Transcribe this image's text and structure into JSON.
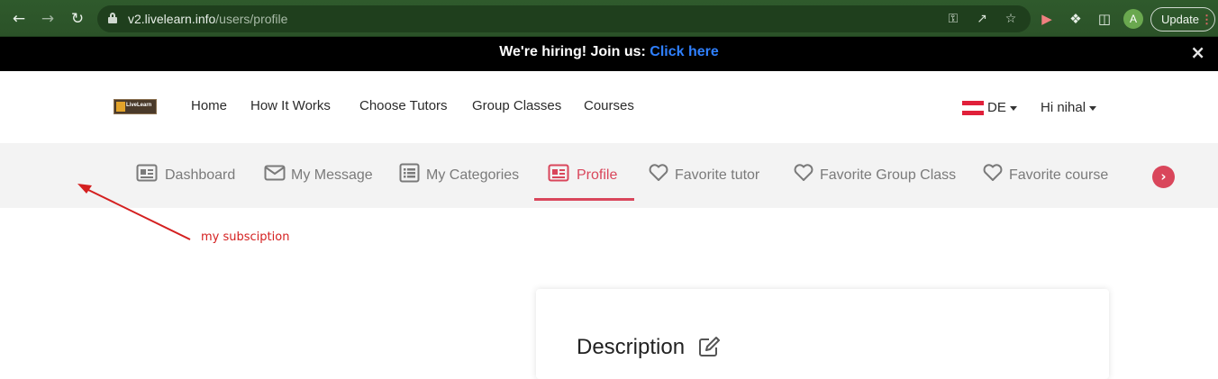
{
  "browser": {
    "back_icon": "arrow-left-icon",
    "forward_icon": "arrow-right-icon",
    "reload_icon": "reload-icon",
    "url_host": "v2.livelearn.info",
    "url_path": "/users/profile",
    "profile_initial": "A",
    "update_label": "Update",
    "update_dots": "⋮"
  },
  "banner": {
    "text": "We're hiring! Join us:",
    "link": "Click here",
    "close": "×"
  },
  "header": {
    "logo_text": "LiveLearn",
    "nav": [
      "Home",
      "How It Works",
      "Choose Tutors",
      "Group Classes",
      "Courses"
    ],
    "lang": "DE",
    "user": "Hi nihal"
  },
  "subnav": {
    "tabs": [
      {
        "label": "Dashboard",
        "icon": "id-card-icon"
      },
      {
        "label": "My Message",
        "icon": "envelope-icon"
      },
      {
        "label": "My Categories",
        "icon": "list-icon"
      },
      {
        "label": "Profile",
        "icon": "id-card-icon",
        "active": true
      },
      {
        "label": "Favorite tutor",
        "icon": "heart-icon"
      },
      {
        "label": "Favorite Group Class",
        "icon": "heart-icon"
      },
      {
        "label": "Favorite course",
        "icon": "heart-icon"
      }
    ],
    "next_icon": "chevron-right-icon"
  },
  "annotation": {
    "text": "my subsciption",
    "color": "#d42020"
  },
  "content": {
    "card_title": "Description"
  },
  "colors": {
    "accent": "#d9465b",
    "banner_link": "#2f80ff",
    "browser_bg": "#2b5228"
  }
}
